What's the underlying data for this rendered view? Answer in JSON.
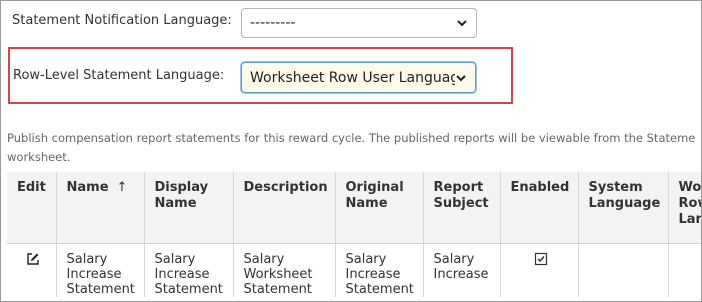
{
  "form": {
    "notification_label": "Statement Notification Language:",
    "notification_value": "---------",
    "row_level_label": "Row-Level Statement Language:",
    "row_level_value": "Worksheet Row User Language"
  },
  "description_line1": "Publish compensation report statements for this reward cycle. The published reports will be viewable from the Stateme",
  "description_line2": "worksheet.",
  "table": {
    "headers": {
      "edit": "Edit",
      "name": "Name",
      "name_sort": "↑",
      "display_name_1": "Display",
      "display_name_2": "Name",
      "description": "Description",
      "original_name_1": "Original",
      "original_name_2": "Name",
      "report_subject_1": "Report",
      "report_subject_2": "Subject",
      "enabled": "Enabled",
      "system_language_1": "System",
      "system_language_2": "Language",
      "worksheet_row_1": "Wo",
      "worksheet_row_2": "Row",
      "worksheet_row_3": "Lan"
    },
    "row": {
      "name": [
        "Salary",
        "Increase",
        "Statement"
      ],
      "display_name": [
        "Salary",
        "Increase",
        "Statement"
      ],
      "description": [
        "Salary",
        "Worksheet",
        "Statement"
      ],
      "original_name": [
        "Salary",
        "Increase",
        "Statement"
      ],
      "report_subject": [
        "Salary",
        "Increase"
      ],
      "enabled": true
    }
  },
  "icons": {
    "edit": "edit-icon",
    "enabled": "checkbox-checked-icon",
    "dropdown": "chevron-down-icon"
  },
  "colors": {
    "highlight_border": "#d64545",
    "selected_field_bg": "#fdfbe8",
    "header_bg": "#f3f3f3"
  }
}
